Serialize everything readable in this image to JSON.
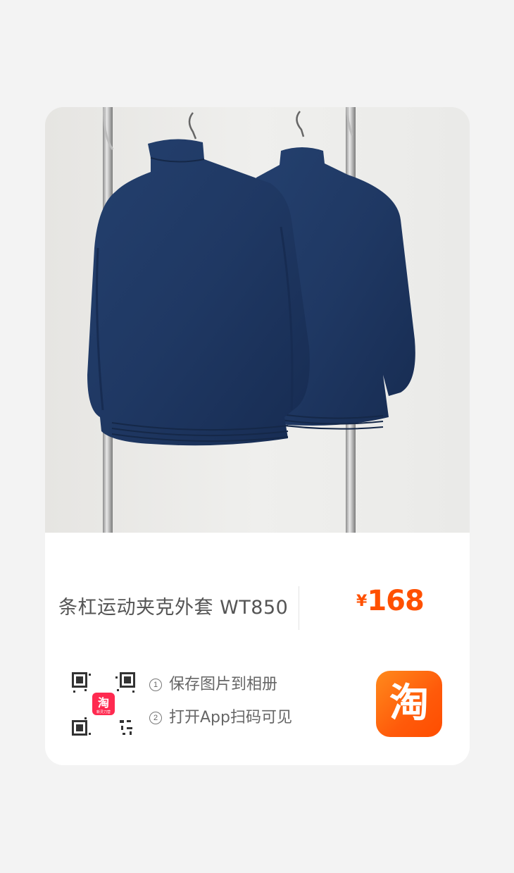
{
  "product": {
    "title": "条杠运动夹克外套 WT850",
    "price_currency": "¥",
    "price_amount": "168",
    "image_alt": "two navy zip track jackets hanging on a rack"
  },
  "instructions": {
    "step1_number": "1",
    "step1_text": "保存图片到相册",
    "step2_number": "2",
    "step2_text": "打开App扫码可见"
  },
  "qr": {
    "center_logo_text": "淘",
    "center_logo_subtext": "新灵刀营"
  },
  "app_logo": {
    "glyph": "淘"
  },
  "colors": {
    "accent": "#ff5000",
    "jacket": "#1e3560",
    "card_background": "#ffffff",
    "page_background": "#f3f3f3"
  }
}
